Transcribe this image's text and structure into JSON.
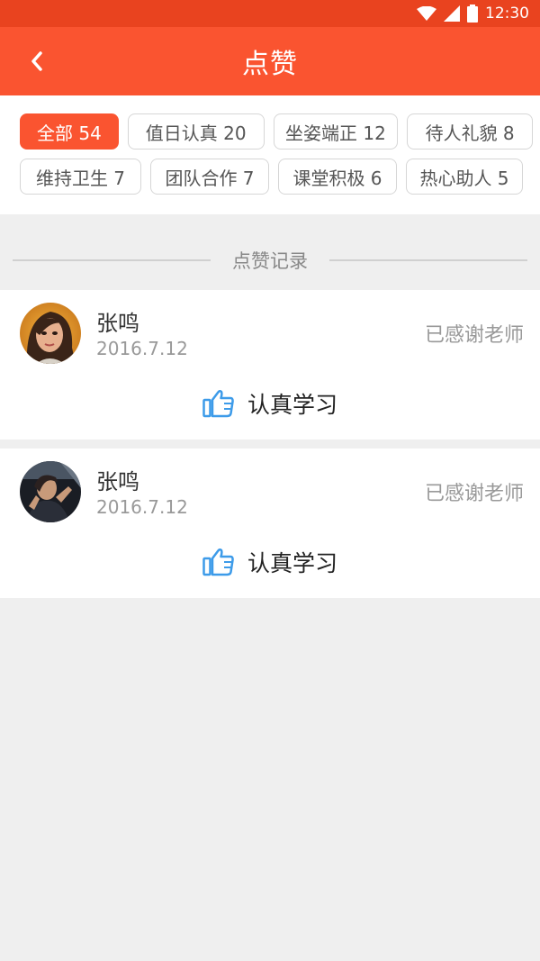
{
  "status_bar": {
    "time": "12:30",
    "icons": [
      "wifi-icon",
      "cellular-icon",
      "battery-icon"
    ]
  },
  "header": {
    "title": "点赞",
    "back_icon": "chevron-left-icon"
  },
  "filters": {
    "row1": [
      {
        "label": "全部 54",
        "active": true
      },
      {
        "label": "值日认真 20",
        "active": false
      },
      {
        "label": "坐姿端正 12",
        "active": false
      },
      {
        "label": "待人礼貌 8",
        "active": false
      }
    ],
    "row2": [
      {
        "label": "维持卫生 7",
        "active": false
      },
      {
        "label": "团队合作 7",
        "active": false
      },
      {
        "label": "课堂积极 6",
        "active": false
      },
      {
        "label": "热心助人 5",
        "active": false
      }
    ]
  },
  "section": {
    "title": "点赞记录"
  },
  "records": [
    {
      "name": "张鸣",
      "date": "2016.7.12",
      "status": "已感谢老师",
      "praise": "认真学习",
      "praise_icon": "thumbs-up-icon"
    },
    {
      "name": "张鸣",
      "date": "2016.7.12",
      "status": "已感谢老师",
      "praise": "认真学习",
      "praise_icon": "thumbs-up-icon"
    }
  ],
  "colors": {
    "accent": "#fa5430",
    "status_bar": "#e9431f",
    "praise_icon": "#3d9be9",
    "background": "#efefef"
  }
}
